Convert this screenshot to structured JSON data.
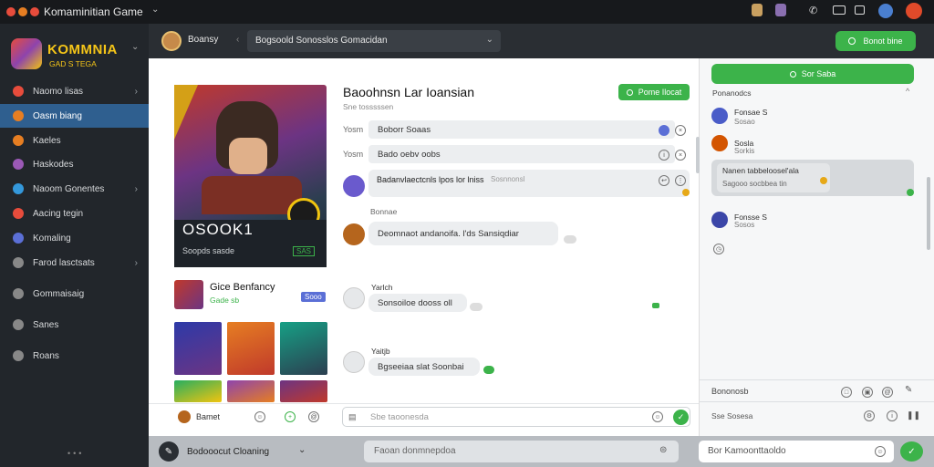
{
  "window": {
    "title": "Komaminitian Game",
    "dropdown_icon": "chevron-down-icon"
  },
  "brand": {
    "name": "KOMMNIA",
    "tagline": "GAD S TEGA"
  },
  "sidebar": {
    "items": [
      {
        "label": "Naomo lisas",
        "icon": "home-icon",
        "color": "#e74c3c",
        "chevron": true,
        "active": false
      },
      {
        "label": "Oasm biang",
        "icon": "game-icon",
        "color": "#e67e22",
        "chevron": false,
        "active": true
      },
      {
        "label": "Kaeles",
        "icon": "flame-icon",
        "color": "#e67e22",
        "chevron": false,
        "active": false
      },
      {
        "label": "Haskodes",
        "icon": "tag-icon",
        "color": "#9b59b6",
        "chevron": false,
        "active": false
      },
      {
        "label": "Naoom Gonentes",
        "icon": "chat-icon",
        "color": "#3498db",
        "chevron": true,
        "active": false
      },
      {
        "label": "Aacing tegin",
        "icon": "user-icon",
        "color": "#e74c3c",
        "chevron": false,
        "active": false
      },
      {
        "label": "Komaling",
        "icon": "group-icon",
        "color": "#5b6fd6",
        "chevron": false,
        "active": false
      },
      {
        "label": "Farod lasctsats",
        "icon": "settings-icon",
        "color": "#888",
        "chevron": true,
        "active": false
      },
      {
        "label": "Gommaisaig",
        "icon": "people-icon",
        "color": "#888",
        "chevron": false,
        "active": false
      },
      {
        "label": "Sanes",
        "icon": "person-icon",
        "color": "#888",
        "chevron": false,
        "active": false
      },
      {
        "label": "Roans",
        "icon": "list-icon",
        "color": "#888",
        "chevron": false,
        "active": false
      }
    ]
  },
  "topbar": {
    "user": "Boansy",
    "search_value": "Bogsoold Sonosslos Gomacidan",
    "action": "Bonot bine"
  },
  "profile": {
    "title": "Baoohnsn Lar Ioansian",
    "subtitle": "Sne tosssssen",
    "score": "OSOOK1",
    "caption": "Soopds sasde",
    "badge": "SAS"
  },
  "fields": [
    {
      "label": "Yosm",
      "value": "Boborr Soaas"
    },
    {
      "label": "Yosm",
      "value": "Bado oebv oobs"
    }
  ],
  "follow_button": "Pome Ilocat",
  "messages": [
    {
      "text": "Badanvlaectcnls lpos lor lniss",
      "meta": "Sosnnonsl"
    },
    {
      "name": "Bonnae",
      "text": "Deomnaot andanoifa. l'ds Sansiqdiar"
    },
    {
      "name": "Yarlch",
      "text": "Sonsoiloe dooss oll"
    },
    {
      "name": "Yaitjb",
      "text": "Bgseeiaa slat Soonbai"
    }
  ],
  "gallery": {
    "title": "Gice Benfancy",
    "subtitle": "Gade sb",
    "badge": "Sooo"
  },
  "footer_user": "Bamet",
  "composer": {
    "placeholder": "Sbe taoonesda"
  },
  "right": {
    "top_button": "Sor Saba",
    "header": "Ponanodcs",
    "items": [
      {
        "name": "Fonsae S",
        "sub": "Sosao"
      },
      {
        "name": "Sosla",
        "sub": "Sorkis"
      },
      {
        "name": "Fonsse S",
        "sub": "Sosos"
      }
    ],
    "bubble_title": "Nanen tabbeloosel'ala",
    "bubble_sub": "Sagooo socbbea tin",
    "footer_label": "Bononosb",
    "search_label": "Sse Sosesa"
  },
  "bottombar": {
    "status": "Bodooocut Cloaning",
    "input_placeholder": "Faoan donmnepdoa",
    "right_input": "Bor Kamoonttaoldo"
  }
}
